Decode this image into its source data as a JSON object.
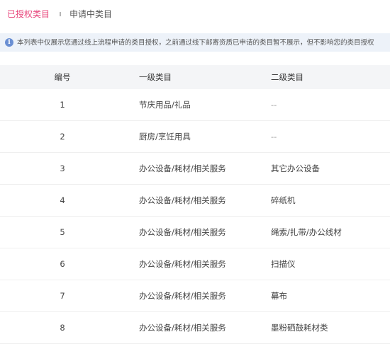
{
  "tabs": {
    "active_label": "已授权类目",
    "inactive_label": "申请中类目"
  },
  "notice": {
    "icon": "info-icon",
    "icon_glyph": "i",
    "text": "本列表中仅展示您通过线上流程申请的类目授权，之前通过线下邮寄资质已申请的类目暂不展示，但不影响您的类目授权"
  },
  "table": {
    "headers": {
      "num": "编号",
      "level1": "一级类目",
      "level2": "二级类目"
    },
    "rows": [
      {
        "num": "1",
        "level1": "节庆用品/礼品",
        "level2": "--"
      },
      {
        "num": "2",
        "level1": "厨房/烹饪用具",
        "level2": "--"
      },
      {
        "num": "3",
        "level1": "办公设备/耗材/相关服务",
        "level2": "其它办公设备"
      },
      {
        "num": "4",
        "level1": "办公设备/耗材/相关服务",
        "level2": "碎纸机"
      },
      {
        "num": "5",
        "level1": "办公设备/耗材/相关服务",
        "level2": "绳索/扎带/办公线材"
      },
      {
        "num": "6",
        "level1": "办公设备/耗材/相关服务",
        "level2": "扫描仪"
      },
      {
        "num": "7",
        "level1": "办公设备/耗材/相关服务",
        "level2": "幕布"
      },
      {
        "num": "8",
        "level1": "办公设备/耗材/相关服务",
        "level2": "墨粉硒鼓耗材类"
      }
    ]
  },
  "colors": {
    "accent": "#e8467c",
    "notice_bg": "#edf2f9",
    "info_icon": "#6a8fd3",
    "header_bg": "#f4f5f7"
  }
}
